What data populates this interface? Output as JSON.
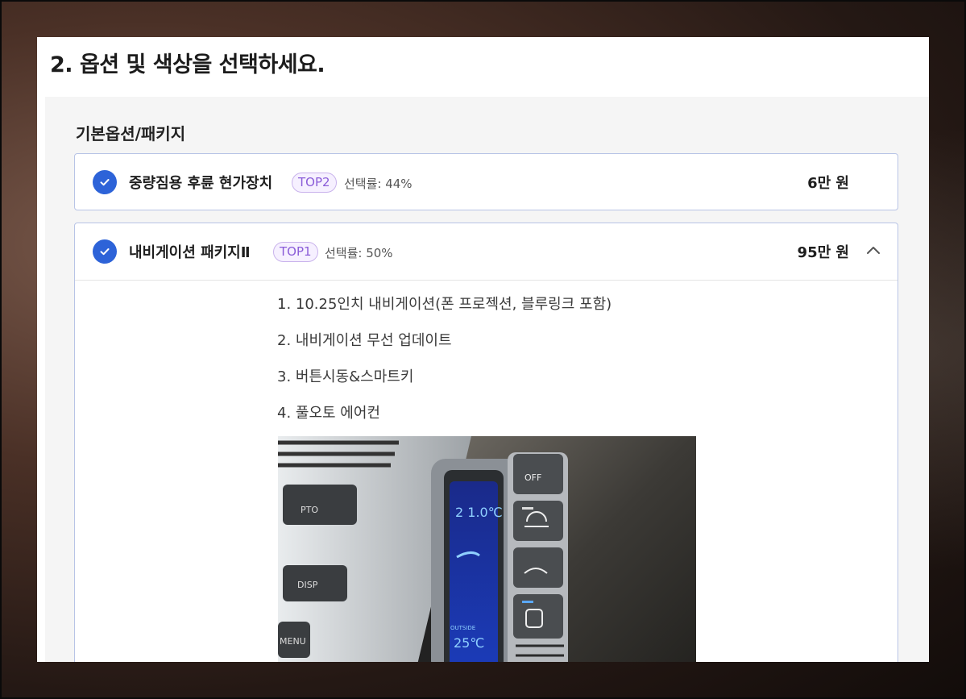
{
  "page": {
    "title": "2. 옵션 및 색상을 선택하세요."
  },
  "section": {
    "heading": "기본옵션/패키지"
  },
  "options": [
    {
      "name": "중량짐용 후륜 현가장치",
      "badge": "TOP2",
      "rate": "선택률: 44%",
      "price_num": "6",
      "price_unit": "만 원",
      "checked": true
    },
    {
      "name": "내비게이션 패키지Ⅱ",
      "badge": "TOP1",
      "rate": "선택률: 50%",
      "price_num": "95",
      "price_unit": "만 원",
      "checked": true,
      "expanded": true,
      "details": [
        "1. 10.25인치 내비게이션(폰 프로젝션, 블루링크 포함)",
        "2. 내비게이션 무선 업데이트",
        "3. 버튼시동&스마트키",
        "4. 풀오토 에어컨"
      ],
      "image_labels": {
        "off": "OFF",
        "pto": "PTO",
        "disp": "DISP",
        "menu": "MENU",
        "temp": "2 1.0℃",
        "outside": "OUTSIDE",
        "outside_temp": "25℃"
      }
    }
  ],
  "colors": {
    "accent_blue": "#2d63d8",
    "badge_purple": "#8a5cd8",
    "card_border": "#b8c4e6"
  },
  "icons": {
    "check": "check-circle-icon",
    "collapse": "chevron-up-icon"
  }
}
